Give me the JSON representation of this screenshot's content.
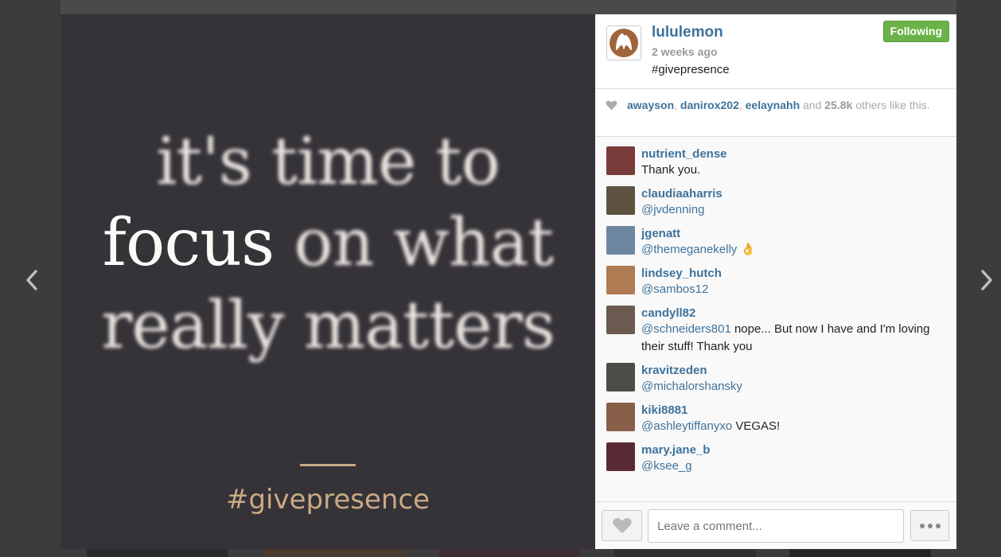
{
  "post": {
    "username": "lululemon",
    "time_ago": "2 weeks ago",
    "caption": "#givepresence",
    "follow_label": "Following"
  },
  "image_text": {
    "line1": "it's time to",
    "line2_focus": "focus",
    "line2_rest": "on what",
    "line3": "really matters",
    "hashtag": "#givepresence"
  },
  "likes": {
    "users": [
      "awayson",
      "danirox202",
      "eelaynahh"
    ],
    "sep1": ", ",
    "sep2": ", ",
    "and_text": " and ",
    "count": "25.8k",
    "suffix": " others like this."
  },
  "comments": [
    {
      "user": "nutrient_dense",
      "mention": "",
      "text": "Thank you.",
      "avatar_color": "#7a3b3b"
    },
    {
      "user": "claudiaaharris",
      "mention": "@jvdenning",
      "text": "",
      "avatar_color": "#5e5340"
    },
    {
      "user": "jgenatt",
      "mention": "@themeganekelly",
      "text": " 👌",
      "avatar_color": "#6f86a0"
    },
    {
      "user": "lindsey_hutch",
      "mention": "@sambos12",
      "text": "",
      "avatar_color": "#b07a52"
    },
    {
      "user": "candyll82",
      "mention": "@schneiders801",
      "text": " nope... But now I have and I'm loving their stuff! Thank you",
      "avatar_color": "#6b5a4f"
    },
    {
      "user": "kravitzeden",
      "mention": "@michalorshansky",
      "text": "",
      "avatar_color": "#4d4b46"
    },
    {
      "user": "kiki8881",
      "mention": "@ashleytiffanyxo",
      "text": " VEGAS!",
      "avatar_color": "#8a5f4a"
    },
    {
      "user": "mary.jane_b",
      "mention": "@ksee_g",
      "text": "",
      "avatar_color": "#5a2a35"
    }
  ],
  "footer": {
    "comment_placeholder": "Leave a comment..."
  },
  "colors": {
    "link": "#3f729b",
    "follow_green": "#6bb349",
    "accent_gold": "#c9aa84"
  },
  "icons": [
    "chevron-left-icon",
    "chevron-right-icon",
    "lululemon-logo",
    "heart-icon",
    "more-dots-icon"
  ]
}
